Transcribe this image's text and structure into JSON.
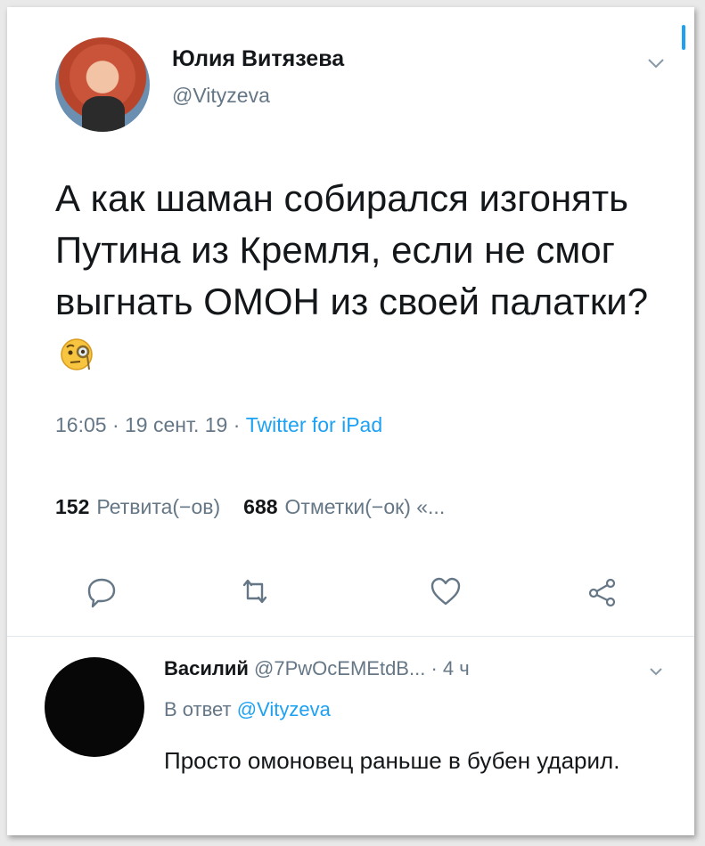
{
  "tweet": {
    "author_name": "Юлия Витязева",
    "author_handle": "@Vityzeva",
    "text": "А как шаман собирался изгонять Путина из Кремля, если не смог выгнать ОМОН из своей палатки?",
    "emoji": "face-with-monocle-icon",
    "time": "16:05 · 19 сент. 19 · ",
    "source": "Twitter for iPad",
    "retweets_count": "152",
    "retweets_label": "Ретвита(−ов)",
    "likes_count": "688",
    "likes_label": "Отметки(−ок) «..."
  },
  "reply": {
    "author_name": "Василий",
    "author_handle": "@7PwOcEMEtdB...",
    "time": " · 4 ч",
    "reply_prefix": "В ответ ",
    "reply_mention": "@Vityzeva",
    "text": "Просто омоновец раньше в бубен ударил."
  },
  "colors": {
    "link": "#1da1f2",
    "secondary_text": "#657786",
    "primary_text": "#14171a"
  }
}
